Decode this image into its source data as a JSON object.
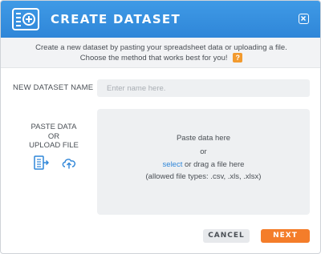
{
  "header": {
    "title": "CREATE DATASET",
    "background": "#3a93e0",
    "icon": "dataset-add-icon"
  },
  "subheader": {
    "line1": "Create a new dataset by pasting your spreadsheet data or uploading a file.",
    "line2": "Choose the method that works best for you!",
    "help_label": "?"
  },
  "name_field": {
    "label": "NEW DATASET NAME",
    "placeholder": "Enter name here.",
    "value": ""
  },
  "source": {
    "label_line1": "PASTE DATA",
    "label_line2": "OR",
    "label_line3": "UPLOAD FILE",
    "paste_icon": "paste-data-icon",
    "upload_icon": "upload-file-icon"
  },
  "drop_zone": {
    "paste_text": "Paste data here",
    "or_text": "or",
    "select_link": "select",
    "drag_text": " or drag a file here",
    "allowed_types": "(allowed file types: .csv, .xls, .xlsx)"
  },
  "buttons": {
    "cancel": "CANCEL",
    "next": "NEXT",
    "next_color": "#f47d2a"
  }
}
